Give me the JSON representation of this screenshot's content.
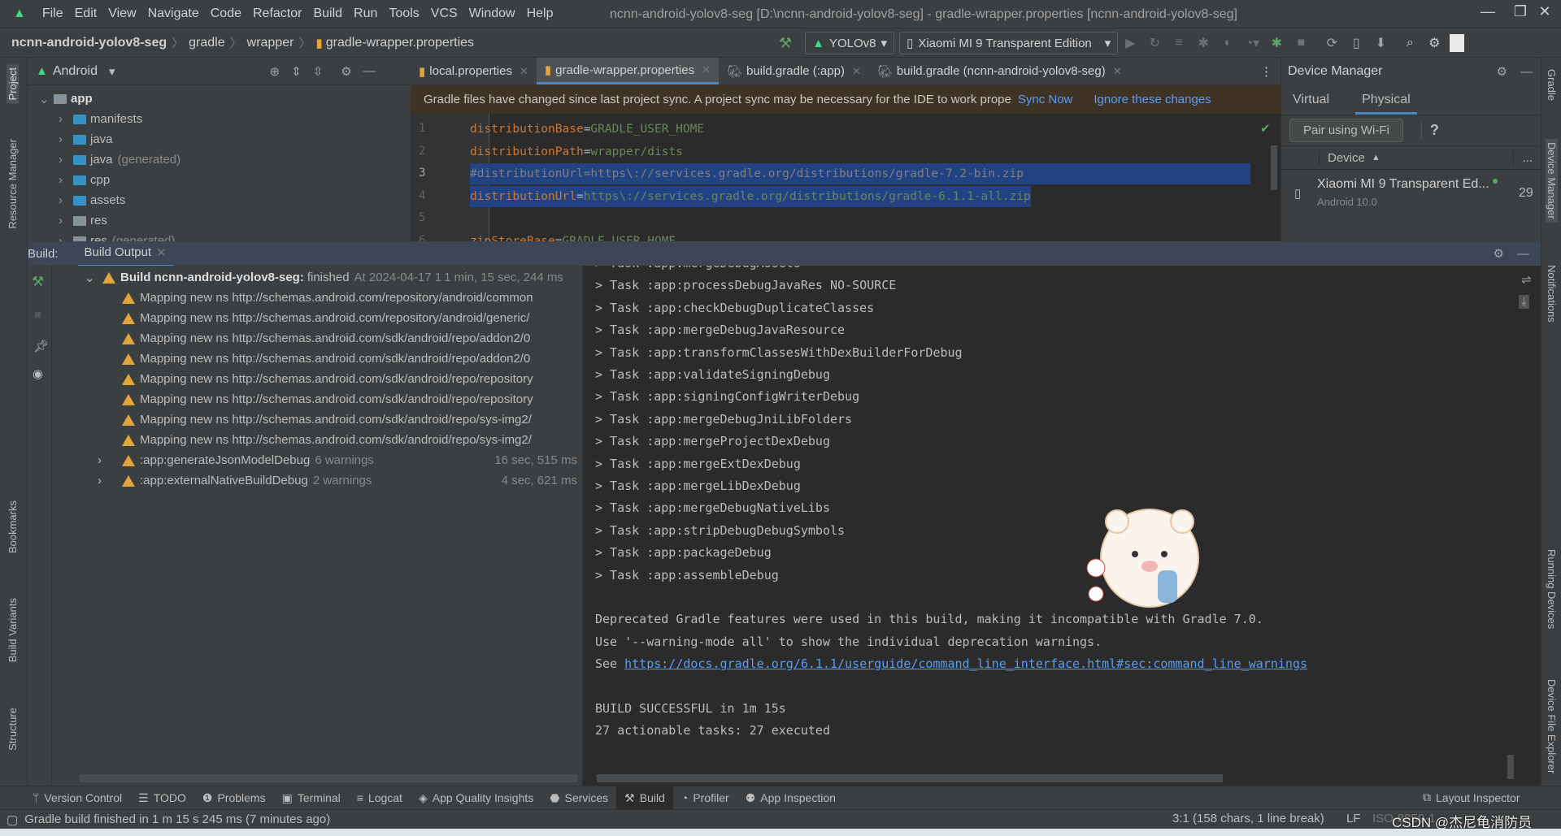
{
  "menu": {
    "items": [
      "File",
      "Edit",
      "View",
      "Navigate",
      "Code",
      "Refactor",
      "Build",
      "Run",
      "Tools",
      "VCS",
      "Window",
      "Help"
    ],
    "title": "ncnn-android-yolov8-seg [D:\\ncnn-android-yolov8-seg] - gradle-wrapper.properties [ncnn-android-yolov8-seg]"
  },
  "breadcrumb": [
    "ncnn-android-yolov8-seg",
    "gradle",
    "wrapper",
    "gradle-wrapper.properties"
  ],
  "toolbar": {
    "config": "YOLOv8",
    "device": "Xiaomi MI 9 Transparent Edition"
  },
  "left_strip": [
    "Project",
    "Resource Manager",
    "Bookmarks",
    "Build Variants",
    "Structure"
  ],
  "right_strip": [
    "Gradle",
    "Device Manager",
    "Notifications",
    "Running Devices",
    "Device File Explorer"
  ],
  "project": {
    "view": "Android",
    "tree": [
      {
        "label": "app",
        "level": 0,
        "icon": "module"
      },
      {
        "label": "manifests",
        "level": 1,
        "icon": "folder"
      },
      {
        "label": "java",
        "level": 1,
        "icon": "folder"
      },
      {
        "label": "java",
        "suffix": "(generated)",
        "level": 1,
        "icon": "folder"
      },
      {
        "label": "cpp",
        "level": 1,
        "icon": "folder"
      },
      {
        "label": "assets",
        "level": 1,
        "icon": "folder"
      },
      {
        "label": "res",
        "level": 1,
        "icon": "folder-gray"
      },
      {
        "label": "res",
        "suffix": "(generated)",
        "level": 1,
        "icon": "folder-gray"
      }
    ]
  },
  "editor": {
    "tabs": [
      {
        "label": "local.properties",
        "active": false
      },
      {
        "label": "gradle-wrapper.properties",
        "active": true
      },
      {
        "label": "build.gradle (:app)",
        "active": false
      },
      {
        "label": "build.gradle (ncnn-android-yolov8-seg)",
        "active": false
      }
    ],
    "banner": {
      "text": "Gradle files have changed since last project sync. A project sync may be necessary for the IDE to work prope",
      "sync": "Sync Now",
      "ignore": "Ignore these changes"
    },
    "lines": [
      {
        "n": "1",
        "key": "distributionBase",
        "val": "GRADLE_USER_HOME"
      },
      {
        "n": "2",
        "key": "distributionPath",
        "val": "wrapper/dists"
      },
      {
        "n": "3",
        "comment": "#distributionUrl=https\\://services.gradle.org/distributions/gradle-7.2-bin.zip"
      },
      {
        "n": "4",
        "key": "distributionUrl",
        "val": "https\\://services.gradle.org/distributions/gradle-6.1.1-all.zip"
      },
      {
        "n": "5"
      },
      {
        "n": "6",
        "key": "zipStoreBase",
        "val": "GRADLE_USER_HOME"
      }
    ]
  },
  "device_manager": {
    "title": "Device Manager",
    "tabs": [
      "Virtual",
      "Physical"
    ],
    "active_tab": "Physical",
    "pair_button": "Pair using Wi-Fi",
    "help": "?",
    "col_device": "Device",
    "col_more": "...",
    "device": {
      "name": "Xiaomi MI 9 Transparent Ed...",
      "os": "Android 10.0",
      "api": "29",
      "online_color": "#59a869"
    }
  },
  "build": {
    "label": "Build:",
    "tab": "Build Output",
    "root": {
      "bold": "Build ncnn-android-yolov8-seg:",
      "status": "finished",
      "time": "At 2024-04-17 1",
      "duration": "1 min, 15 sec, 244 ms"
    },
    "warnings": [
      "Mapping new ns http://schemas.android.com/repository/android/common",
      "Mapping new ns http://schemas.android.com/repository/android/generic/",
      "Mapping new ns http://schemas.android.com/sdk/android/repo/addon2/0",
      "Mapping new ns http://schemas.android.com/sdk/android/repo/addon2/0",
      "Mapping new ns http://schemas.android.com/sdk/android/repo/repository",
      "Mapping new ns http://schemas.android.com/sdk/android/repo/repository",
      "Mapping new ns http://schemas.android.com/sdk/android/repo/sys-img2/",
      "Mapping new ns http://schemas.android.com/sdk/android/repo/sys-img2/"
    ],
    "tasks": [
      {
        "name": ":app:generateJsonModelDebug",
        "count": "6 warnings",
        "duration": "16 sec, 515 ms"
      },
      {
        "name": ":app:externalNativeBuildDebug",
        "count": "2 warnings",
        "duration": "4 sec, 621 ms"
      }
    ],
    "console": [
      "> Task :app:mergeDebugAssets",
      "> Task :app:processDebugJavaRes NO-SOURCE",
      "> Task :app:checkDebugDuplicateClasses",
      "> Task :app:mergeDebugJavaResource",
      "> Task :app:transformClassesWithDexBuilderForDebug",
      "> Task :app:validateSigningDebug",
      "> Task :app:signingConfigWriterDebug",
      "> Task :app:mergeDebugJniLibFolders",
      "> Task :app:mergeProjectDexDebug",
      "> Task :app:mergeExtDexDebug",
      "> Task :app:mergeLibDexDebug",
      "> Task :app:mergeDebugNativeLibs",
      "> Task :app:stripDebugDebugSymbols",
      "> Task :app:packageDebug",
      "> Task :app:assembleDebug",
      "",
      "Deprecated Gradle features were used in this build, making it incompatible with Gradle 7.0.",
      "Use '--warning-mode all' to show the individual deprecation warnings."
    ],
    "see": "See ",
    "link": "https://docs.gradle.org/6.1.1/userguide/command_line_interface.html#sec:command_line_warnings",
    "result": [
      "BUILD SUCCESSFUL in 1m 15s",
      "27 actionable tasks: 27 executed"
    ]
  },
  "bottom_tools": [
    "Version Control",
    "TODO",
    "Problems",
    "Terminal",
    "Logcat",
    "App Quality Insights",
    "Services",
    "Build",
    "Profiler",
    "App Inspection"
  ],
  "layout_inspector": "Layout Inspector",
  "status": {
    "message": "Gradle build finished in 1 m 15 s 245 ms (7 minutes ago)",
    "position": "3:1 (158 chars, 1 line break)",
    "line_sep": "LF",
    "encoding": "ISO-8859-1",
    "watermark": "CSDN @杰尼龟消防员"
  },
  "colors": {
    "accent": "#4a88c7",
    "warning": "#e2a53b",
    "success": "#59a869",
    "link": "#589df6"
  }
}
